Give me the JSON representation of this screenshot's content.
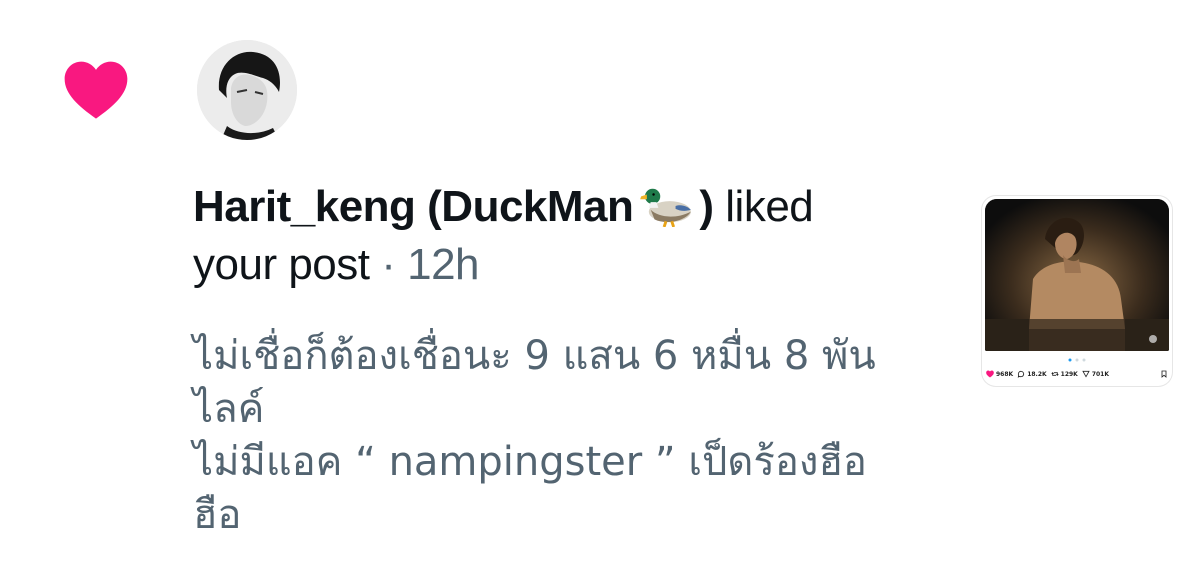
{
  "notification": {
    "user_name": "Harit_keng (DuckMan",
    "user_name_close": ")",
    "action": "liked",
    "action_object": "your post",
    "separator": "·",
    "time": "12h",
    "content_lines": [
      "ไม่เชื่อก็ต้องเชื่อนะ 9 แสน 6 หมื่น 8 พัน",
      "ไลค์",
      "ไม่มีแอค “ nampingster ” เป็ดร้องฮือ",
      "ฮือ"
    ]
  },
  "thumbnail": {
    "stats": {
      "likes": "968K",
      "replies": "18.2K",
      "reposts": "129K",
      "views": "701K"
    }
  },
  "icons": {
    "heart": "heart-icon",
    "duck": "duck-emoji-icon"
  },
  "colors": {
    "heart": "#f91880",
    "secondary_text": "#536471",
    "primary_text": "#0f1419"
  }
}
